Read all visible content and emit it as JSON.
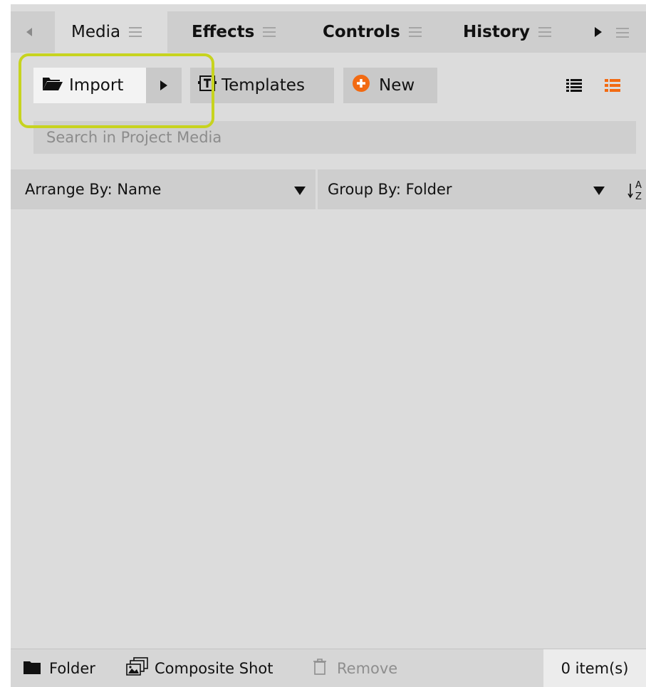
{
  "tabs": [
    {
      "label": "Media",
      "active": true
    },
    {
      "label": "Effects",
      "active": false
    },
    {
      "label": "Controls",
      "active": false
    },
    {
      "label": "History",
      "active": false
    }
  ],
  "toolbar": {
    "import_label": "Import",
    "templates_label": "Templates",
    "new_label": "New",
    "accent_color": "#f26a12",
    "highlight_color": "#c7d31f"
  },
  "search": {
    "placeholder": "Search in Project Media",
    "value": ""
  },
  "arrange": {
    "arrange_label": "Arrange By: Name",
    "group_label": "Group By: Folder"
  },
  "footer": {
    "folder_label": "Folder",
    "composite_label": "Composite Shot",
    "remove_label": "Remove",
    "item_count": "0 item(s)"
  },
  "icons": [
    "tab-scroll-left-icon",
    "menu-icon",
    "tab-scroll-right-icon",
    "folder-open-icon",
    "dropdown-arrow-icon",
    "templates-icon",
    "plus-circle-icon",
    "list-view-icon",
    "detail-list-view-icon",
    "sort-az-icon",
    "folder-icon",
    "composite-shot-icon",
    "trash-icon"
  ]
}
